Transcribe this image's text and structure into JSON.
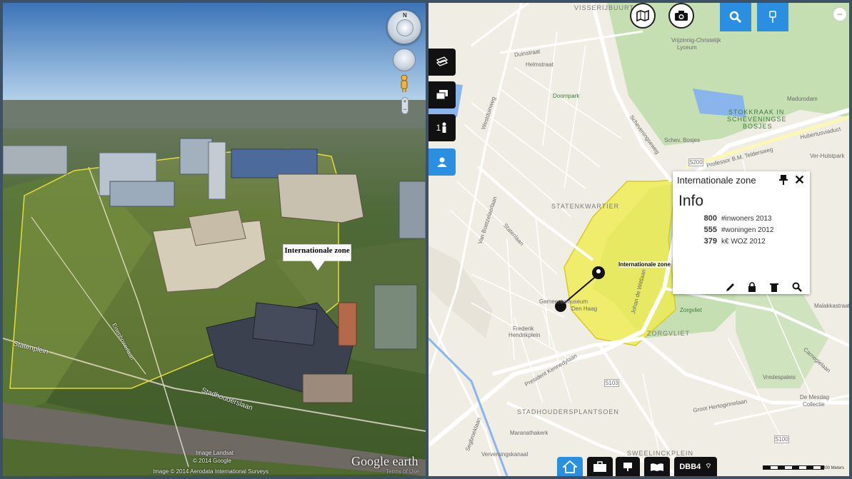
{
  "earth": {
    "nav_compass_letter": "N",
    "zoom_plus": "+",
    "zoom_minus": "−",
    "placemark_label": "Internationale zone",
    "streets": {
      "statenplein": "Statenplein",
      "stadhouderslaan": "Stadhouderslaan",
      "eisenhowerlaan": "Eisenhowerlaan"
    },
    "credits": {
      "landsat": "Image Landsat",
      "google_2014": "© 2014 Google",
      "aerodata": "Image © 2014 Aerodata International Surveys",
      "terms": "Terms of Use"
    },
    "logo": "Google earth"
  },
  "map": {
    "top_buttons": {
      "map_icon": "map-icon",
      "camera_icon": "camera-icon",
      "search_icon": "search-icon",
      "marker_icon": "pin-marker-icon"
    },
    "minimize_label": "–",
    "side_buttons": [
      {
        "name": "layers-stack-icon",
        "label": ""
      },
      {
        "name": "windows-icon",
        "label": ""
      },
      {
        "name": "person-info-icon",
        "label": "1"
      },
      {
        "name": "user-profile-icon",
        "label": ""
      }
    ],
    "zone_label": "Internationale zone",
    "labels": {
      "visserijbuurt": "VISSERIJBUURT",
      "duinstraat": "Duinstraat",
      "helmstraat": "Helmstraat",
      "doornpark": "Doornpark",
      "vrijzinnig": "Vrijzinnig-Christelijk",
      "lyceum": "Lyceum",
      "madurodam": "Madurodam",
      "stokkraak": "STOKKRAAK IN",
      "scheveningse": "SCHEVENINGSE",
      "bosjes": "BOSJES",
      "hubertusviaduct": "Hubertusviaduct",
      "telderseweg": "Professor B.M. Teldersweg",
      "verhulstpark": "Ver-Hulstpark",
      "scheveningseweg": "Scheveningseweg",
      "schev_bosjes": "Schev. Bosjes",
      "westduinweg": "Westduinweg",
      "statenkwartier": "STATENKWARTIER",
      "statenlaan": "Statenlaan",
      "van_boetzelaerlaan": "Van Boetzelaerlaan",
      "gemeentemuseum": "Gemeentemuseum",
      "den_haag": "Den Haag",
      "frederik": "Frederik",
      "hendrikplein": "Hendrikplein",
      "president_kennedylaan": "President Kennedylaan",
      "zorgvliet": "ZORGVLIET",
      "zorgvliet_park": "Zorgvliet",
      "johan_de_witt": "Johan de Wittlaan",
      "stadhoudersplantsoen": "STADHOUDERSPLANTSOEN",
      "maranathakerk": "Maranathakerk",
      "sweelinckplein": "SWEELINCKPLEIN",
      "groot_hertoginnelaan": "Groot Hertoginnelaan",
      "vredespaleis": "Vredespaleis",
      "de_mesdag": "De Mesdag",
      "collectie": "Collectie",
      "carnegielaan": "Carnegielaan",
      "malakkastraat": "Malakkastraat",
      "verversingskanaal": "Verversingskanaal",
      "segbroeklaan": "Segbroeklaan",
      "s200": "S200",
      "s103": "S103",
      "s100": "S100"
    },
    "popup": {
      "title": "Internationale zone",
      "heading": "Info",
      "rows": [
        {
          "value": "800",
          "label": "#inwoners 2013"
        },
        {
          "value": "555",
          "label": "#woningen 2012"
        },
        {
          "value": "379",
          "label": "k€ WOZ 2012"
        }
      ],
      "tools": [
        "pencil-icon",
        "lock-icon",
        "trash-icon",
        "search-icon"
      ]
    },
    "bottom_buttons": [
      {
        "name": "home-icon",
        "label": ""
      },
      {
        "name": "briefcase-icon",
        "label": ""
      },
      {
        "name": "display-icon",
        "label": ""
      },
      {
        "name": "book-icon",
        "label": ""
      },
      {
        "name": "db-status",
        "label": "DBB4"
      }
    ],
    "scale_label": "300 Meters"
  }
}
